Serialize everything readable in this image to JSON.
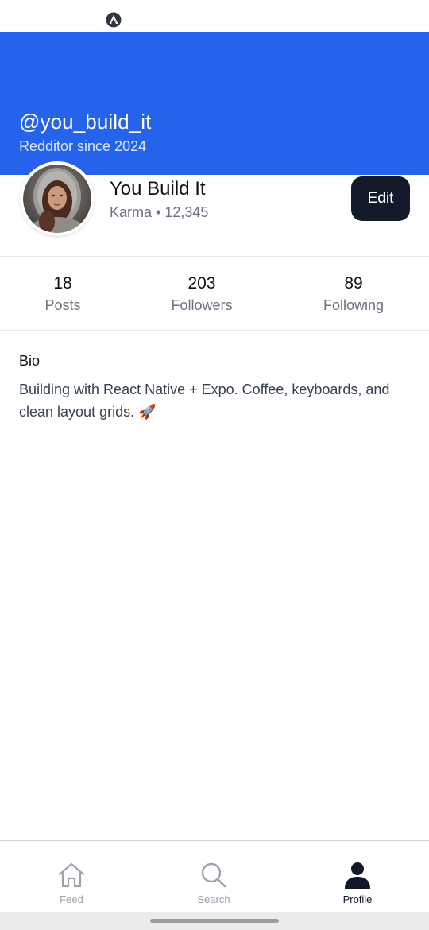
{
  "status_bar": {
    "icon": "expo-a-logo-icon"
  },
  "header": {
    "username": "@you_build_it",
    "member_since": "Redditor since 2024",
    "background_color": "#2563EB"
  },
  "profile": {
    "display_name": "You Build It",
    "karma": "Karma • 12,345",
    "edit_label": "Edit",
    "avatar_icon": "user-photo"
  },
  "stats": [
    {
      "value": "18",
      "label": "Posts"
    },
    {
      "value": "203",
      "label": "Followers"
    },
    {
      "value": "89",
      "label": "Following"
    }
  ],
  "bio": {
    "title": "Bio",
    "text": "Building with React Native + Expo. Coffee, keyboards, and clean layout grids. 🚀"
  },
  "tabs": [
    {
      "label": "Feed",
      "icon": "home-icon",
      "active": false
    },
    {
      "label": "Search",
      "icon": "search-icon",
      "active": false
    },
    {
      "label": "Profile",
      "icon": "person-icon",
      "active": true
    }
  ]
}
